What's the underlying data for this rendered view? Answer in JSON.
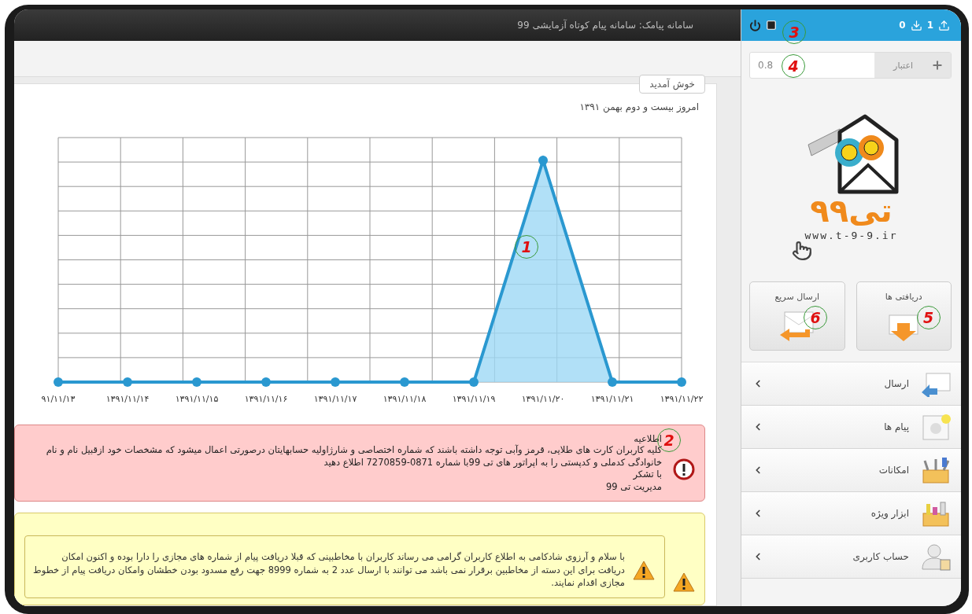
{
  "header": {
    "title": "سامانه پیامک: سامانه پیام کوتاه آزمایشی 99"
  },
  "topbar": {
    "counters": [
      {
        "kind": "upload",
        "count": "1"
      },
      {
        "kind": "download",
        "count": "0"
      }
    ],
    "callout": "3"
  },
  "welcome_tab": "خوش آمدید",
  "today": "امروز  بیست و دوم بهمن ۱۳۹۱",
  "chart": {
    "x_labels": [
      "۱۳۹۱/۱۱/۲۲",
      "۱۳۹۱/۱۱/۲۱",
      "۱۳۹۱/۱۱/۲۰",
      "۱۳۹۱/۱۱/۱۹",
      "۱۳۹۱/۱۱/۱۸",
      "۱۳۹۱/۱۱/۱۷",
      "۱۳۹۱/۱۱/۱۶",
      "۱۳۹۱/۱۱/۱۵",
      "۱۳۹۱/۱۱/۱۴",
      "۹۱/۱۱/۱۳"
    ],
    "callout": "1"
  },
  "notice": {
    "title": "اطلاعیه",
    "lines": [
      "کلیه کاربران کارت های طلایی، قرمز وآبی توجه داشته باشند که شماره اختصاصی و شارژاولیه حسابهایتان درصورتی اعمال میشود که مشخصات خود ازقبیل نام و نام خانوادگی کدملی و کدپستی را به اپراتور های تی 99با شماره  0871-7270859 اطلاع دهید",
      "با تشکر",
      "مدیریت تی 99"
    ],
    "callout": "2"
  },
  "announcement": {
    "text": "با سلام و آرزوی شادکامی به اطلاع کاربران گرامی می رساند کاربران با مخاطبینی که قبلا دریافت پیام از شماره های مجازی را دارا بوده و اکنون امکان دریافت برای این دسته از مخاطبین برقرار نمی باشد می توانند با ارسال عدد 2 به شماره 8999 جهت رفع مسدود بودن خطشان وامکان دریافت پیام از خطوط مجازی اقدام نمایند."
  },
  "credit": {
    "label": "اعتبار",
    "value": "0.8",
    "callout": "4"
  },
  "logo": {
    "wordmark": "تی۹۹",
    "url": "www.t-9-9.ir"
  },
  "quick_buttons": [
    {
      "kind": "inbox",
      "label": "دریافتی ها",
      "callout": "5"
    },
    {
      "kind": "quick-send",
      "label": "ارسال سریع",
      "callout": "6"
    }
  ],
  "menu": [
    {
      "kind": "send",
      "label": "ارسال"
    },
    {
      "kind": "messages",
      "label": "پیام ها"
    },
    {
      "kind": "features",
      "label": "امکانات"
    },
    {
      "kind": "tools",
      "label": "ابزار ویژه"
    },
    {
      "kind": "account",
      "label": "حساب کاربری"
    }
  ]
}
